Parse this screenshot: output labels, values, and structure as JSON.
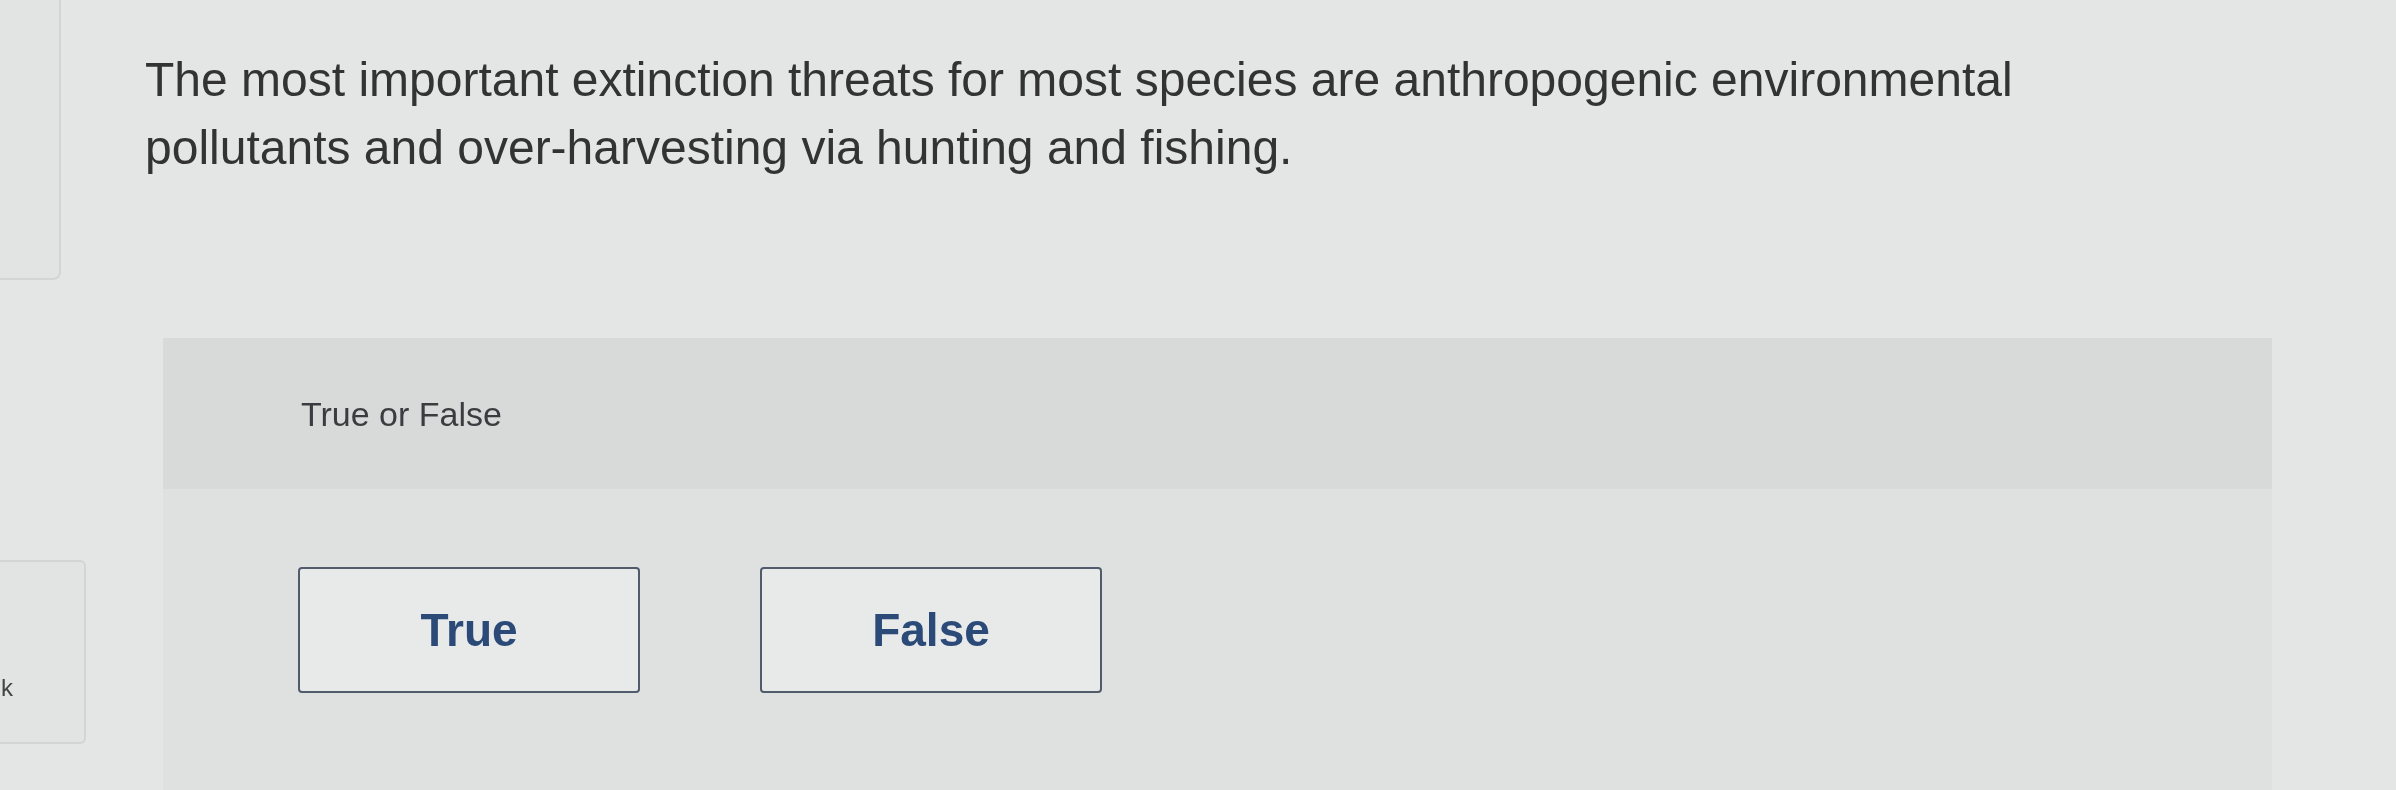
{
  "side_card": {
    "text": "k"
  },
  "question": {
    "text": "The most important extinction threats for most species are anthropogenic environmental pollutants and over-harvesting via hunting and fishing."
  },
  "answer_panel": {
    "prompt": "True or False",
    "options": [
      {
        "label": "True",
        "selected": false
      },
      {
        "label": "False",
        "selected": false
      }
    ]
  }
}
